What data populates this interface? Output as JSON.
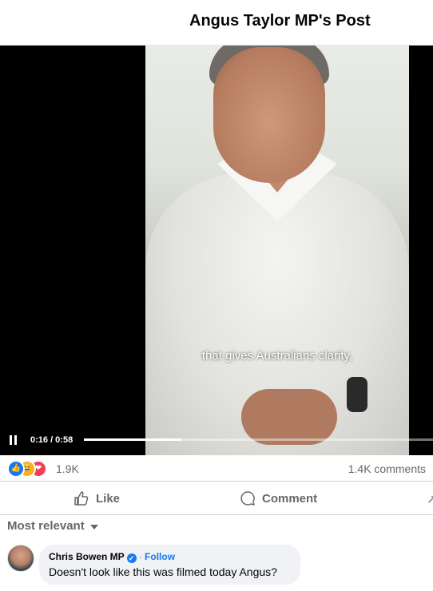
{
  "header": {
    "title": "Angus Taylor MP's Post"
  },
  "video": {
    "caption": "that gives Australians clarity,",
    "time_display": "0:16 / 0:58",
    "progress_fraction": 0.28
  },
  "stats": {
    "reaction_icons": [
      "like-icon",
      "haha-icon",
      "love-icon"
    ],
    "reaction_count": "1.9K",
    "comment_count": "1.4K comments"
  },
  "actions": {
    "like_label": "Like",
    "comment_label": "Comment"
  },
  "filter": {
    "label": "Most relevant"
  },
  "comments": [
    {
      "author": "Chris Bowen MP",
      "separator": "·",
      "follow_label": "Follow",
      "text": "Doesn't look like this was filmed today Angus?"
    }
  ],
  "colors": {
    "accent": "#1877f2",
    "muted": "#65676b"
  }
}
